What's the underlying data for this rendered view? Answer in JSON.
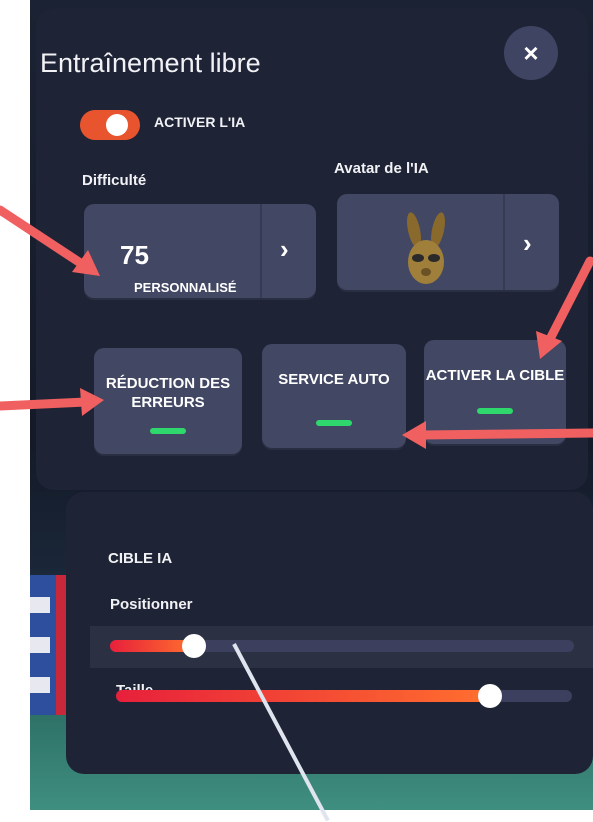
{
  "panel": {
    "title": "Entraînement libre",
    "close_label": "×",
    "ai_toggle": {
      "label": "ACTIVER L'IA",
      "on": true,
      "color": "#e8542e"
    },
    "difficulty": {
      "label": "Difficulté",
      "value": "75",
      "mode": "PERSONNALISÉ",
      "arrow": "›"
    },
    "avatar": {
      "label": "Avatar de l'IA",
      "icon": "rabbit-avatar-icon",
      "arrow": "›"
    },
    "options": [
      {
        "label": "RÉDUCTION DES ERREURS",
        "enabled": true
      },
      {
        "label": "SERVICE AUTO",
        "enabled": true
      },
      {
        "label": "ACTIVER LA CIBLE",
        "enabled": true
      }
    ]
  },
  "target": {
    "title": "CIBLE IA",
    "position": {
      "label": "Positionner",
      "level": 0.18
    },
    "size": {
      "label": "Taille",
      "level": 0.82
    }
  },
  "colors": {
    "panel_bg": "#1e2435",
    "card_bg": "#424763",
    "accent": "#e8542e",
    "indicator_on": "#2fd86d",
    "annotation": "#f06060"
  }
}
